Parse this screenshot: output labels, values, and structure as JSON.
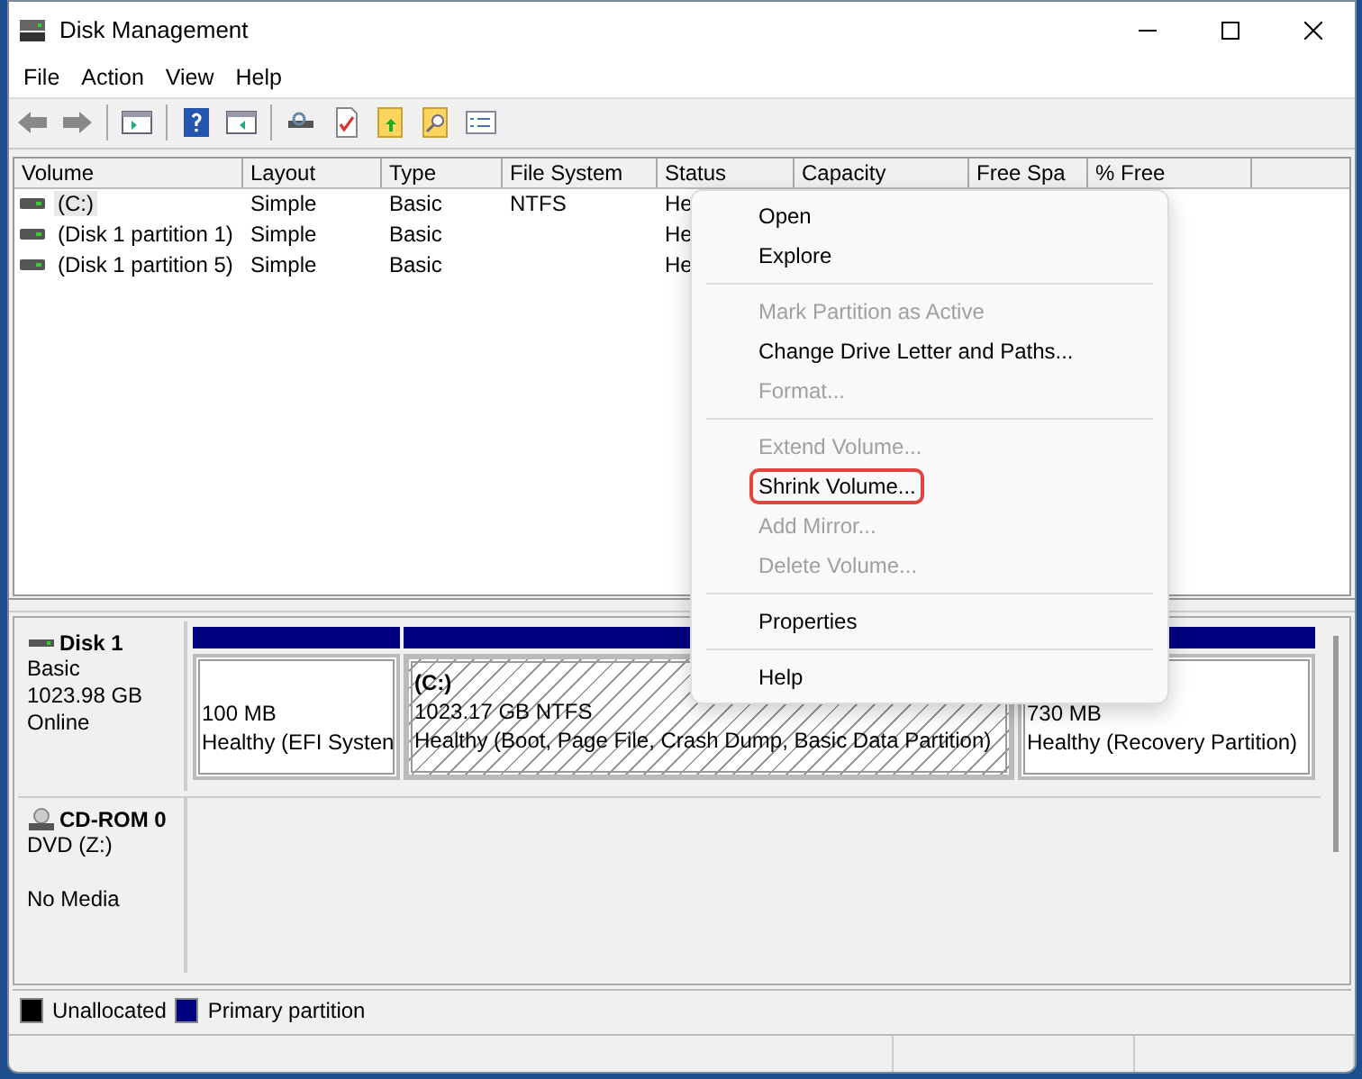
{
  "window": {
    "title": "Disk Management"
  },
  "menu_bar": [
    "File",
    "Action",
    "View",
    "Help"
  ],
  "table": {
    "columns": [
      "Volume",
      "Layout",
      "Type",
      "File System",
      "Status",
      "Capacity",
      "Free Spa",
      "% Free"
    ],
    "rows": [
      {
        "selected": true,
        "cells": [
          "(C:)",
          "Simple",
          "Basic",
          "NTFS",
          "He"
        ]
      },
      {
        "selected": false,
        "cells": [
          "(Disk 1 partition 1)",
          "Simple",
          "Basic",
          "",
          "He"
        ]
      },
      {
        "selected": false,
        "cells": [
          "(Disk 1 partition 5)",
          "Simple",
          "Basic",
          "",
          "He"
        ]
      }
    ]
  },
  "disks": [
    {
      "kind": "disk",
      "name": "Disk 1",
      "lines": [
        "Basic",
        "1023.98 GB",
        "Online"
      ],
      "partitions": [
        {
          "size": "100 MB",
          "status": "Healthy (EFI Systen",
          "selected": false
        },
        {
          "label": "(C:)",
          "size": "1023.17 GB NTFS",
          "status": "Healthy (Boot, Page File, Crash Dump, Basic Data Partition)",
          "selected": true
        },
        {
          "size": "730 MB",
          "status": "Healthy (Recovery Partition)",
          "selected": false
        }
      ]
    },
    {
      "kind": "cdrom",
      "name": "CD-ROM 0",
      "lines": [
        "DVD (Z:)",
        "No Media"
      ]
    }
  ],
  "legend": [
    {
      "label": "Unallocated",
      "color": "#000000"
    },
    {
      "label": "Primary partition",
      "color": "#000080"
    }
  ],
  "context_menu": [
    [
      {
        "label": "Open",
        "disabled": false,
        "highlighted": false
      },
      {
        "label": "Explore",
        "disabled": false,
        "highlighted": false
      }
    ],
    [
      {
        "label": "Mark Partition as Active",
        "disabled": true,
        "highlighted": false
      },
      {
        "label": "Change Drive Letter and Paths...",
        "disabled": false,
        "highlighted": false
      },
      {
        "label": "Format...",
        "disabled": true,
        "highlighted": false
      }
    ],
    [
      {
        "label": "Extend Volume...",
        "disabled": true,
        "highlighted": false
      },
      {
        "label": "Shrink Volume...",
        "disabled": false,
        "highlighted": true
      },
      {
        "label": "Add Mirror...",
        "disabled": true,
        "highlighted": false
      },
      {
        "label": "Delete Volume...",
        "disabled": true,
        "highlighted": false
      }
    ],
    [
      {
        "label": "Properties",
        "disabled": false,
        "highlighted": false
      }
    ],
    [
      {
        "label": "Help",
        "disabled": false,
        "highlighted": false
      }
    ]
  ]
}
